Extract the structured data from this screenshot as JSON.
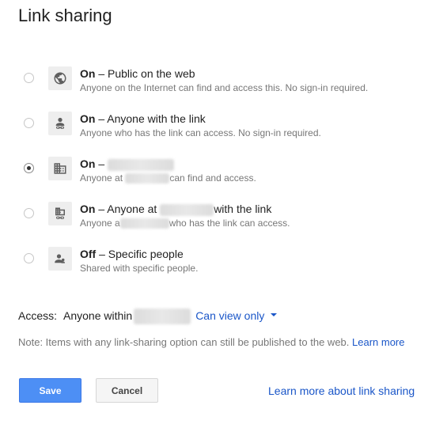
{
  "dialog": {
    "title": "Link sharing"
  },
  "options": [
    {
      "title_bold": "On",
      "title_rest": " – Public on the web",
      "description": "Anyone on the Internet can find and access this. No sign-in required.",
      "icon": "globe-icon",
      "selected": false
    },
    {
      "title_bold": "On",
      "title_rest": " – Anyone with the link",
      "description": "Anyone who has the link can access. No sign-in required.",
      "icon": "person-link-icon",
      "selected": false
    },
    {
      "title_bold": "On",
      "title_rest": " – ",
      "description_pre": "Anyone at ",
      "description_post": "can find and access.",
      "icon": "building-icon",
      "selected": true
    },
    {
      "title_bold": "On",
      "title_pre": " – Anyone at ",
      "title_post": "with the link",
      "description_pre": "Anyone a",
      "description_post": "who has the link can access.",
      "icon": "building-link-icon",
      "selected": false
    },
    {
      "title_bold": "Off",
      "title_rest": " – Specific people",
      "description": "Shared with specific people.",
      "icon": "people-icon",
      "selected": false
    }
  ],
  "access": {
    "label": "Access:",
    "value_pre": "Anyone within",
    "permission": "Can view only"
  },
  "note": {
    "text": "Note: Items with any link-sharing option can still be published to the web. ",
    "link": "Learn more"
  },
  "buttons": {
    "save": "Save",
    "cancel": "Cancel"
  },
  "footer_link": "Learn more about link sharing",
  "colors": {
    "link": "#1a56c8",
    "save_bg": "#4d8ff5",
    "muted_text": "#777777"
  }
}
